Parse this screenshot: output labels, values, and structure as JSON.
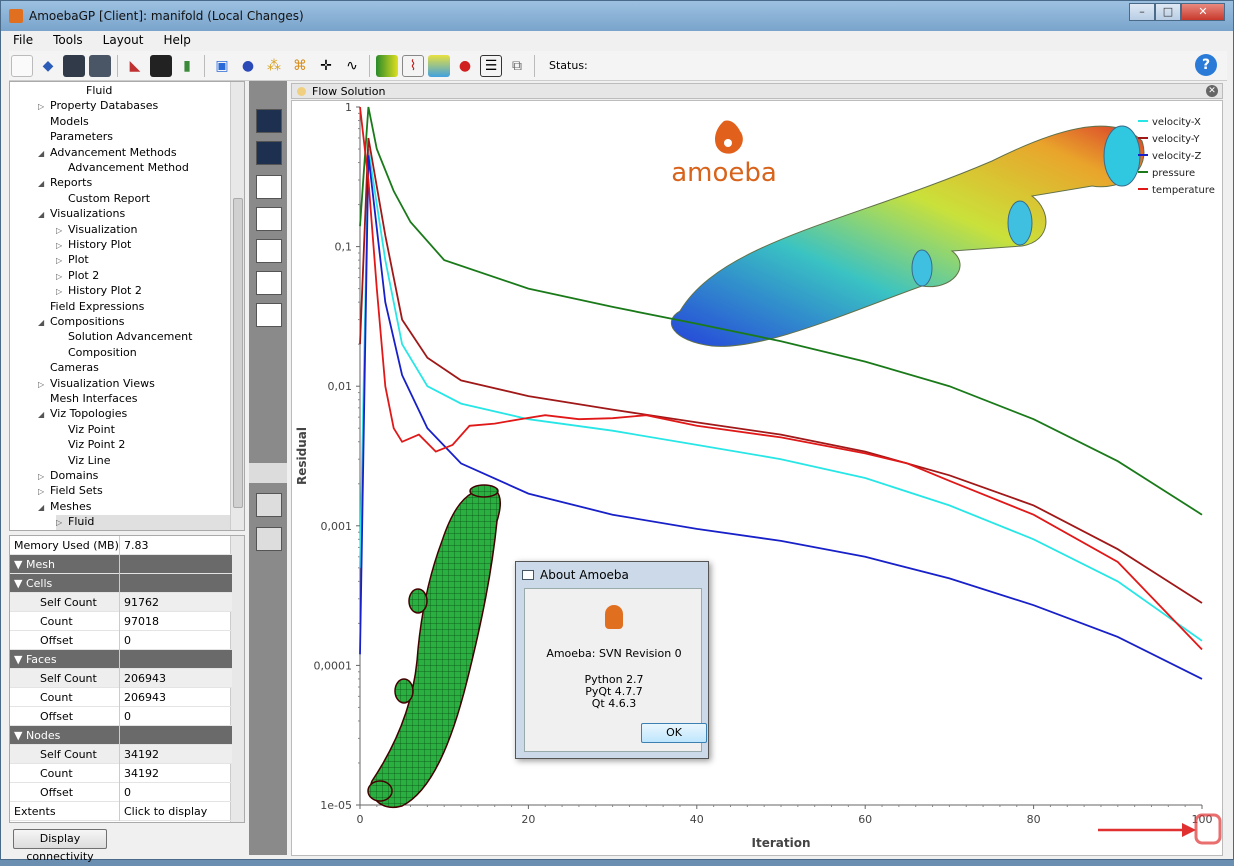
{
  "window": {
    "title": "AmoebaGP [Client]: manifold (Local Changes)"
  },
  "menu": [
    "File",
    "Tools",
    "Layout",
    "Help"
  ],
  "toolbar": {
    "status_label": "Status:"
  },
  "tree": [
    {
      "label": "Fluid",
      "indent": 3,
      "arrow": "",
      "sel": false
    },
    {
      "label": "Property Databases",
      "indent": 1,
      "arrow": "▷",
      "sel": false
    },
    {
      "label": "Models",
      "indent": 1,
      "arrow": "",
      "sel": false
    },
    {
      "label": "Parameters",
      "indent": 1,
      "arrow": "",
      "sel": false
    },
    {
      "label": "Advancement Methods",
      "indent": 1,
      "arrow": "◢",
      "sel": false
    },
    {
      "label": "Advancement Method",
      "indent": 2,
      "arrow": "",
      "sel": false
    },
    {
      "label": "Reports",
      "indent": 1,
      "arrow": "◢",
      "sel": false
    },
    {
      "label": "Custom Report",
      "indent": 2,
      "arrow": "",
      "sel": false
    },
    {
      "label": "Visualizations",
      "indent": 1,
      "arrow": "◢",
      "sel": false
    },
    {
      "label": "Visualization",
      "indent": 2,
      "arrow": "▷",
      "sel": false
    },
    {
      "label": "History Plot",
      "indent": 2,
      "arrow": "▷",
      "sel": false
    },
    {
      "label": "Plot",
      "indent": 2,
      "arrow": "▷",
      "sel": false
    },
    {
      "label": "Plot 2",
      "indent": 2,
      "arrow": "▷",
      "sel": false
    },
    {
      "label": "History Plot 2",
      "indent": 2,
      "arrow": "▷",
      "sel": false
    },
    {
      "label": "Field Expressions",
      "indent": 1,
      "arrow": "",
      "sel": false
    },
    {
      "label": "Compositions",
      "indent": 1,
      "arrow": "◢",
      "sel": false
    },
    {
      "label": "Solution Advancement",
      "indent": 2,
      "arrow": "",
      "sel": false
    },
    {
      "label": "Composition",
      "indent": 2,
      "arrow": "",
      "sel": false
    },
    {
      "label": "Cameras",
      "indent": 1,
      "arrow": "",
      "sel": false
    },
    {
      "label": "Visualization Views",
      "indent": 1,
      "arrow": "▷",
      "sel": false
    },
    {
      "label": "Mesh Interfaces",
      "indent": 1,
      "arrow": "",
      "sel": false
    },
    {
      "label": "Viz Topologies",
      "indent": 1,
      "arrow": "◢",
      "sel": false
    },
    {
      "label": "Viz Point",
      "indent": 2,
      "arrow": "",
      "sel": false
    },
    {
      "label": "Viz Point 2",
      "indent": 2,
      "arrow": "",
      "sel": false
    },
    {
      "label": "Viz Line",
      "indent": 2,
      "arrow": "",
      "sel": false
    },
    {
      "label": "Domains",
      "indent": 1,
      "arrow": "▷",
      "sel": false
    },
    {
      "label": "Field Sets",
      "indent": 1,
      "arrow": "▷",
      "sel": false
    },
    {
      "label": "Meshes",
      "indent": 1,
      "arrow": "◢",
      "sel": false
    },
    {
      "label": "Fluid",
      "indent": 2,
      "arrow": "▷",
      "sel": true
    }
  ],
  "properties": [
    {
      "k": "Memory Used (MB)",
      "v": "7.83",
      "type": "plain"
    },
    {
      "k": "▼ Mesh",
      "v": "",
      "type": "hdr"
    },
    {
      "k": "  ▼ Cells",
      "v": "",
      "type": "hdr"
    },
    {
      "k": "Self Count",
      "v": "91762",
      "type": "sub"
    },
    {
      "k": "Count",
      "v": "97018",
      "type": "plain"
    },
    {
      "k": "Offset",
      "v": "0",
      "type": "plain"
    },
    {
      "k": "  ▼ Faces",
      "v": "",
      "type": "hdr"
    },
    {
      "k": "Self Count",
      "v": "206943",
      "type": "sub"
    },
    {
      "k": "Count",
      "v": "206943",
      "type": "plain"
    },
    {
      "k": "Offset",
      "v": "0",
      "type": "plain"
    },
    {
      "k": "  ▼ Nodes",
      "v": "",
      "type": "hdr"
    },
    {
      "k": "Self Count",
      "v": "34192",
      "type": "sub"
    },
    {
      "k": "Count",
      "v": "34192",
      "type": "plain"
    },
    {
      "k": "Offset",
      "v": "0",
      "type": "plain"
    },
    {
      "k": "Extents",
      "v": "Click to display",
      "type": "plain"
    }
  ],
  "display_connectivity_label": "Display connectivity",
  "panel": {
    "title": "Flow Solution"
  },
  "logo_text": "amoeba",
  "about": {
    "title": "About Amoeba",
    "line1": "Amoeba: SVN Revision 0",
    "line2": "Python 2.7",
    "line3": "PyQt 4.7.7",
    "line4": "Qt 4.6.3",
    "ok_label": "OK"
  },
  "colors": {
    "velocity_x": "#28e6e6",
    "velocity_y": "#a01818",
    "velocity_z": "#1820c8",
    "pressure": "#1a7a1a",
    "temperature": "#e01818",
    "annotation_arrow": "#e03030"
  },
  "chart_data": {
    "type": "line",
    "xlabel": "Iteration",
    "ylabel": "Residual",
    "yscale": "log",
    "xlim": [
      0,
      100
    ],
    "ylim": [
      1e-05,
      1
    ],
    "xticks": [
      "0",
      "20",
      "40",
      "60",
      "80",
      "100"
    ],
    "yticks": [
      "1",
      "0,1",
      "0,01",
      "0,001",
      "0,0001",
      "1e-05"
    ],
    "legend_position": "top-right",
    "series": [
      {
        "name": "velocity-X",
        "color": "#28e6e6",
        "points": [
          [
            0,
            0.0005
          ],
          [
            1,
            0.5
          ],
          [
            3,
            0.08
          ],
          [
            5,
            0.02
          ],
          [
            8,
            0.01
          ],
          [
            12,
            0.0075
          ],
          [
            20,
            0.0058
          ],
          [
            30,
            0.0048
          ],
          [
            40,
            0.0038
          ],
          [
            50,
            0.003
          ],
          [
            60,
            0.0022
          ],
          [
            70,
            0.0014
          ],
          [
            80,
            0.0008
          ],
          [
            90,
            0.0004
          ],
          [
            100,
            0.00015
          ]
        ]
      },
      {
        "name": "velocity-Y",
        "color": "#a01818",
        "points": [
          [
            0,
            0.02
          ],
          [
            1,
            0.6
          ],
          [
            3,
            0.12
          ],
          [
            5,
            0.03
          ],
          [
            8,
            0.016
          ],
          [
            12,
            0.011
          ],
          [
            20,
            0.0085
          ],
          [
            30,
            0.0068
          ],
          [
            40,
            0.0055
          ],
          [
            50,
            0.0045
          ],
          [
            60,
            0.0034
          ],
          [
            70,
            0.0023
          ],
          [
            80,
            0.0014
          ],
          [
            90,
            0.00068
          ],
          [
            100,
            0.00028
          ]
        ]
      },
      {
        "name": "velocity-Z",
        "color": "#1820c8",
        "points": [
          [
            0,
            0.00012
          ],
          [
            1,
            0.45
          ],
          [
            3,
            0.04
          ],
          [
            5,
            0.012
          ],
          [
            8,
            0.005
          ],
          [
            12,
            0.0028
          ],
          [
            20,
            0.0017
          ],
          [
            30,
            0.0012
          ],
          [
            40,
            0.00095
          ],
          [
            50,
            0.00078
          ],
          [
            60,
            0.0006
          ],
          [
            70,
            0.00042
          ],
          [
            80,
            0.00027
          ],
          [
            90,
            0.00016
          ],
          [
            100,
            8e-05
          ]
        ]
      },
      {
        "name": "pressure",
        "color": "#1a7a1a",
        "points": [
          [
            0,
            0.14
          ],
          [
            1,
            1.0
          ],
          [
            2,
            0.5
          ],
          [
            4,
            0.25
          ],
          [
            6,
            0.15
          ],
          [
            10,
            0.08
          ],
          [
            20,
            0.05
          ],
          [
            30,
            0.037
          ],
          [
            40,
            0.028
          ],
          [
            50,
            0.021
          ],
          [
            60,
            0.015
          ],
          [
            70,
            0.01
          ],
          [
            80,
            0.0058
          ],
          [
            90,
            0.0029
          ],
          [
            100,
            0.0012
          ]
        ]
      },
      {
        "name": "temperature",
        "color": "#e01818",
        "points": [
          [
            0,
            1.0
          ],
          [
            1,
            0.3
          ],
          [
            2,
            0.05
          ],
          [
            3,
            0.01
          ],
          [
            4,
            0.005
          ],
          [
            5,
            0.004
          ],
          [
            7,
            0.0045
          ],
          [
            9,
            0.0034
          ],
          [
            11,
            0.0038
          ],
          [
            13,
            0.0052
          ],
          [
            16,
            0.0054
          ],
          [
            19,
            0.0058
          ],
          [
            22,
            0.0062
          ],
          [
            26,
            0.0058
          ],
          [
            30,
            0.0059
          ],
          [
            34,
            0.0062
          ],
          [
            40,
            0.0052
          ],
          [
            50,
            0.0043
          ],
          [
            60,
            0.0033
          ],
          [
            65,
            0.0028
          ],
          [
            70,
            0.0021
          ],
          [
            80,
            0.0012
          ],
          [
            90,
            0.00055
          ],
          [
            100,
            0.00013
          ]
        ]
      }
    ]
  }
}
